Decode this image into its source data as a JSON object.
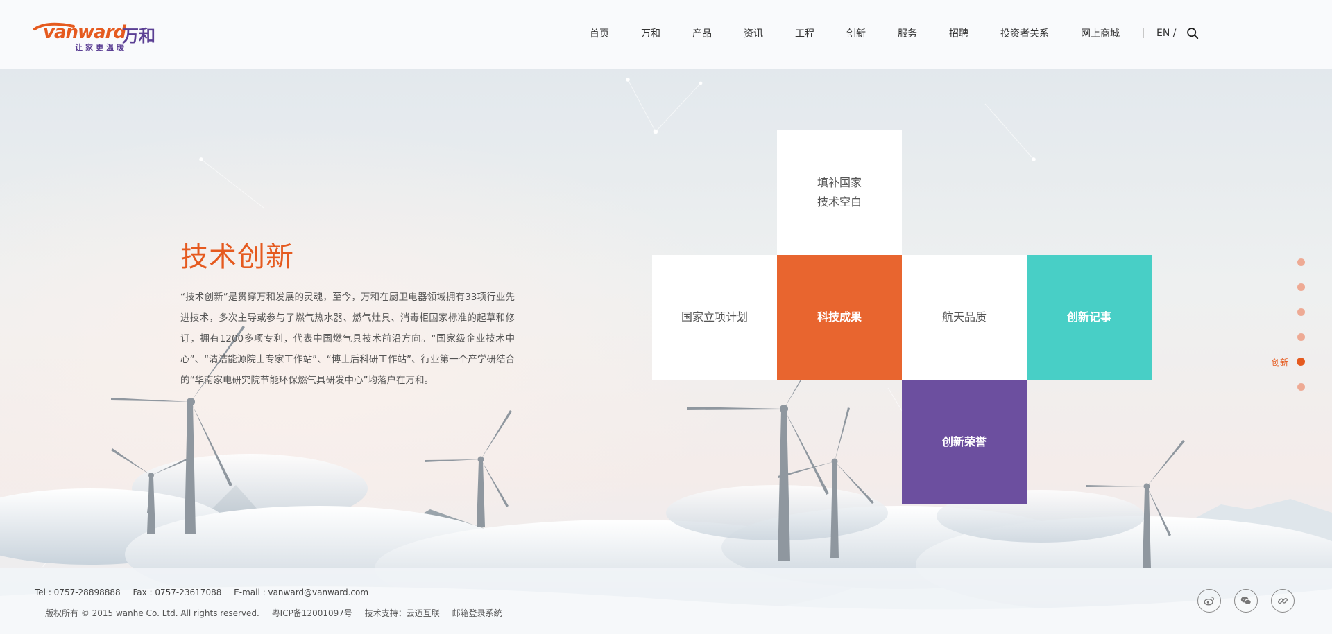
{
  "header": {
    "logo": {
      "wordmark": "vanward",
      "cn": "万和",
      "tagline": "让家更温暖"
    },
    "nav": [
      {
        "label": "首页"
      },
      {
        "label": "万和"
      },
      {
        "label": "产品"
      },
      {
        "label": "资讯"
      },
      {
        "label": "工程"
      },
      {
        "label": "创新"
      },
      {
        "label": "服务"
      },
      {
        "label": "招聘"
      },
      {
        "label": "投资者关系"
      },
      {
        "label": "网上商城"
      }
    ],
    "lang": "EN /",
    "search_icon": "search-icon"
  },
  "intro": {
    "title": "技术创新",
    "body": "“技术创新”是贯穿万和发展的灵魂，至今，万和在厨卫电器领域拥有33项行业先进技术，多次主导或参与了燃气热水器、燃气灶具、消毒柜国家标准的起草和修订，拥有1200多项专利，代表中国燃气具技术前沿方向。“国家级企业技术中心”、“清洁能源院士专家工作站”、“博士后科研工作站”、行业第一个产学研结合的“华南家电研究院节能环保燃气具研发中心”均落户在万和。"
  },
  "tiles": {
    "top": {
      "line1": "填补国家",
      "line2": "技术空白"
    },
    "left": {
      "label": "国家立项计划"
    },
    "center": {
      "label": "科技成果"
    },
    "right": {
      "label": "航天品质"
    },
    "far_right": {
      "label": "创新记事"
    },
    "bottom": {
      "label": "创新荣誉"
    }
  },
  "colors": {
    "accent": "#e55a1f",
    "tile_orange": "#e8652f",
    "tile_teal": "#48cfc6",
    "tile_purple": "#6c4f9f",
    "brand_purple": "#5b3f94"
  },
  "side_nav": {
    "active_label": "创新",
    "active_index": 4,
    "count": 6
  },
  "footer": {
    "tel": "Tel : 0757-28898888",
    "fax": "Fax : 0757-23617088",
    "email": "E-mail : vanward@vanward.com",
    "copyright": "版权所有 © 2015 wanhe Co. Ltd. All rights reserved.",
    "icp": "粤ICP备12001097号",
    "support": "技术支持：云迈互联",
    "mail_login": "邮箱登录系统"
  },
  "social": {
    "weibo_icon": "weibo-icon",
    "wechat_icon": "wechat-icon",
    "link_icon": "link-icon"
  }
}
